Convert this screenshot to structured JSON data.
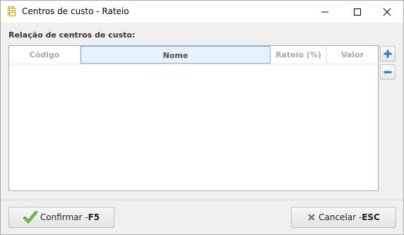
{
  "window": {
    "title": "Centros de custo - Rateio",
    "icon": "document-icon"
  },
  "controls": {
    "minimize": "minimize-icon",
    "maximize": "maximize-icon",
    "close": "close-icon"
  },
  "list": {
    "label": "Relação de centros de custo:",
    "columns": [
      "Código",
      "Nome",
      "Rateio (%)",
      "Valor"
    ],
    "selected_column": "Nome",
    "rows": []
  },
  "side_buttons": {
    "add": "plus-icon",
    "remove": "minus-icon"
  },
  "footer": {
    "confirm_label": "Confirmar - ",
    "confirm_key": "F5",
    "cancel_label": "Cancelar - ",
    "cancel_key": "ESC"
  },
  "colors": {
    "accent_blue": "#2a78c8",
    "confirm_green": "#4caf2a",
    "selected_header_bg": "#e5f1fb"
  }
}
